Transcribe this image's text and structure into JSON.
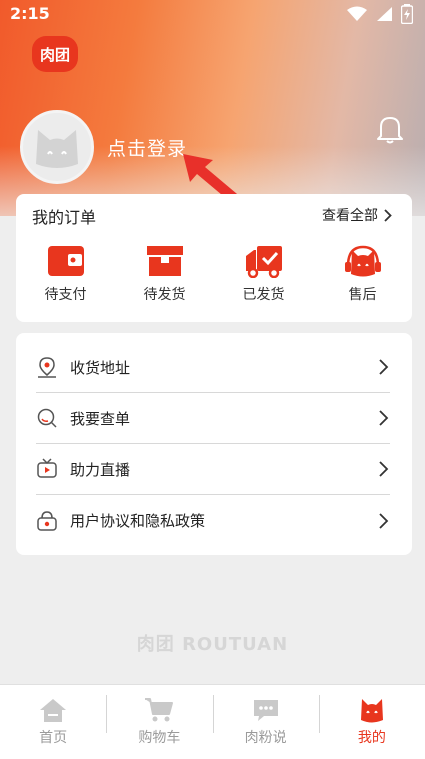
{
  "status": {
    "time": "2:15"
  },
  "logo": {
    "text": "肉团"
  },
  "profile": {
    "login_text": "点击登录"
  },
  "orders": {
    "title": "我的订单",
    "view_all": "查看全部",
    "items": [
      {
        "label": "待支付",
        "icon": "wallet-icon"
      },
      {
        "label": "待发货",
        "icon": "box-icon"
      },
      {
        "label": "已发货",
        "icon": "truck-icon"
      },
      {
        "label": "售后",
        "icon": "headset-icon"
      }
    ]
  },
  "menu": {
    "items": [
      {
        "label": "收货地址",
        "icon": "location-icon"
      },
      {
        "label": "我要查单",
        "icon": "search-icon"
      },
      {
        "label": "助力直播",
        "icon": "tv-icon"
      },
      {
        "label": "用户协议和隐私政策",
        "icon": "lock-icon"
      }
    ]
  },
  "watermark": "肉团 ROUTUAN",
  "tabbar": {
    "items": [
      {
        "label": "首页",
        "icon": "home-icon"
      },
      {
        "label": "购物车",
        "icon": "cart-icon"
      },
      {
        "label": "肉粉说",
        "icon": "chat-icon"
      },
      {
        "label": "我的",
        "icon": "cat-icon"
      }
    ],
    "active": "我的"
  },
  "colors": {
    "accent": "#e8361e",
    "inactive": "#9b9b9b"
  }
}
